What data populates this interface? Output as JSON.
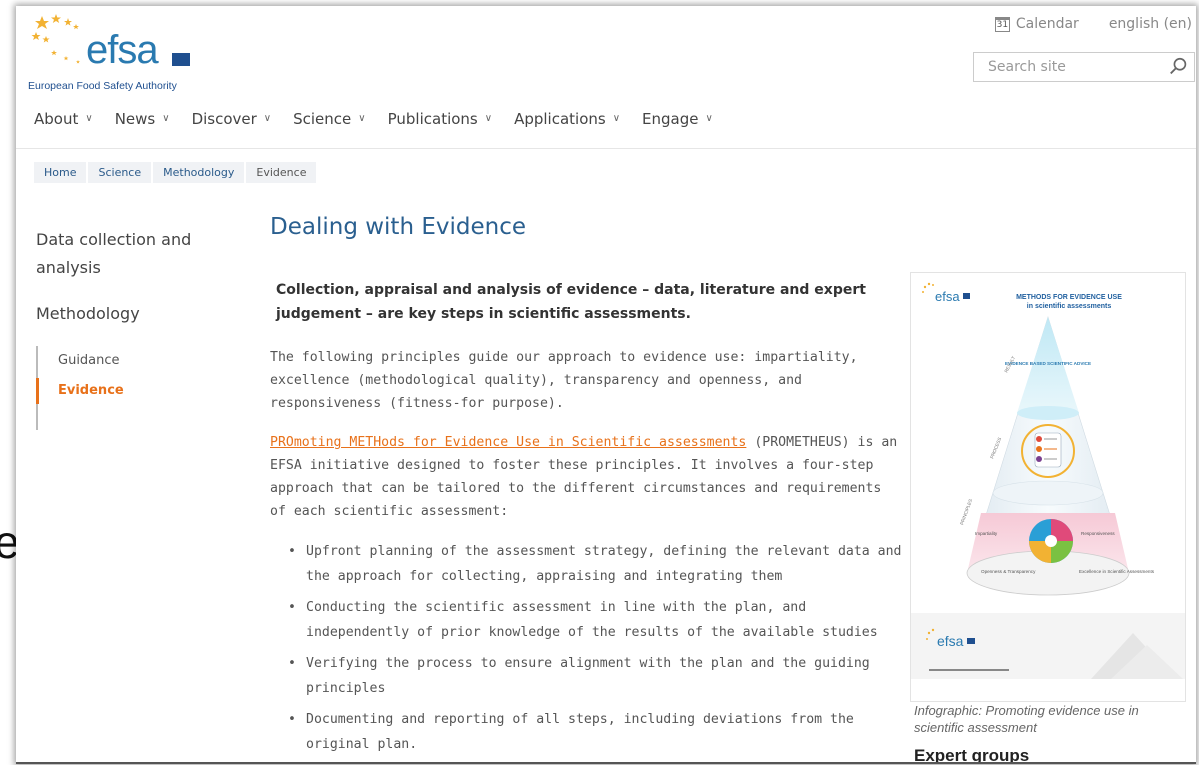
{
  "behind_text": "es",
  "logo": {
    "word": "efsa",
    "tagline": "European Food Safety Authority"
  },
  "top_bar": {
    "calendar_label": "Calendar",
    "calendar_icon_text": "31",
    "language": "english (en)"
  },
  "search": {
    "placeholder": "Search site"
  },
  "main_nav": [
    {
      "label": "About"
    },
    {
      "label": "News"
    },
    {
      "label": "Discover"
    },
    {
      "label": "Science"
    },
    {
      "label": "Publications"
    },
    {
      "label": "Applications"
    },
    {
      "label": "Engage"
    }
  ],
  "breadcrumb": [
    "Home",
    "Science",
    "Methodology",
    "Evidence"
  ],
  "left_nav": {
    "sections": [
      "Data collection and analysis",
      "Methodology"
    ],
    "sub_items": [
      "Guidance",
      "Evidence"
    ],
    "active": "Evidence"
  },
  "page": {
    "title": "Dealing with Evidence",
    "lead": "Collection, appraisal and analysis of evidence – data, literature and expert judgement – are key steps in scientific assessments.",
    "para1": "The following principles guide our approach to evidence use: impartiality, excellence (methodological quality), transparency and openness, and responsiveness (fitness-for purpose).",
    "para2_link": "PROmoting METHods for Evidence Use in Scientific assessments",
    "para2_rest": " (PROMETHEUS) is an EFSA initiative designed to foster these principles. It involves a four-step approach that can be tailored to the different circumstances and requirements of each scientific assessment:",
    "bullets": [
      "Upfront planning of the assessment strategy, defining the relevant data and the approach for collecting, appraising and integrating them",
      "Conducting the scientific assessment in line with the plan, and independently of prior knowledge of the results of the available studies",
      "Verifying the process to ensure alignment with the plan and the guiding principles",
      "Documenting and reporting of all steps, including deviations from the original plan."
    ]
  },
  "infographic": {
    "logo": "efsa",
    "heading_line1": "METHODS FOR EVIDENCE USE",
    "heading_line2": "in scientific assessments",
    "apex_label": "EVIDENCE BASED SCIENTIFIC ADVICE",
    "level_labels": [
      "RESULT",
      "PROCESS",
      "PRINCIPLES"
    ],
    "principles": [
      "Impartiality",
      "Responsiveness",
      "Openness & Transparency",
      "Excellence in Scientific Assessments"
    ],
    "footer_logo": "efsa",
    "caption": "Infographic: Promoting evidence use in scientific assessment"
  },
  "expert_groups_title": "Expert groups",
  "colors": {
    "brand_blue": "#2a7ab0",
    "accent_orange": "#e8711a",
    "title_blue": "#2a5f8f"
  }
}
